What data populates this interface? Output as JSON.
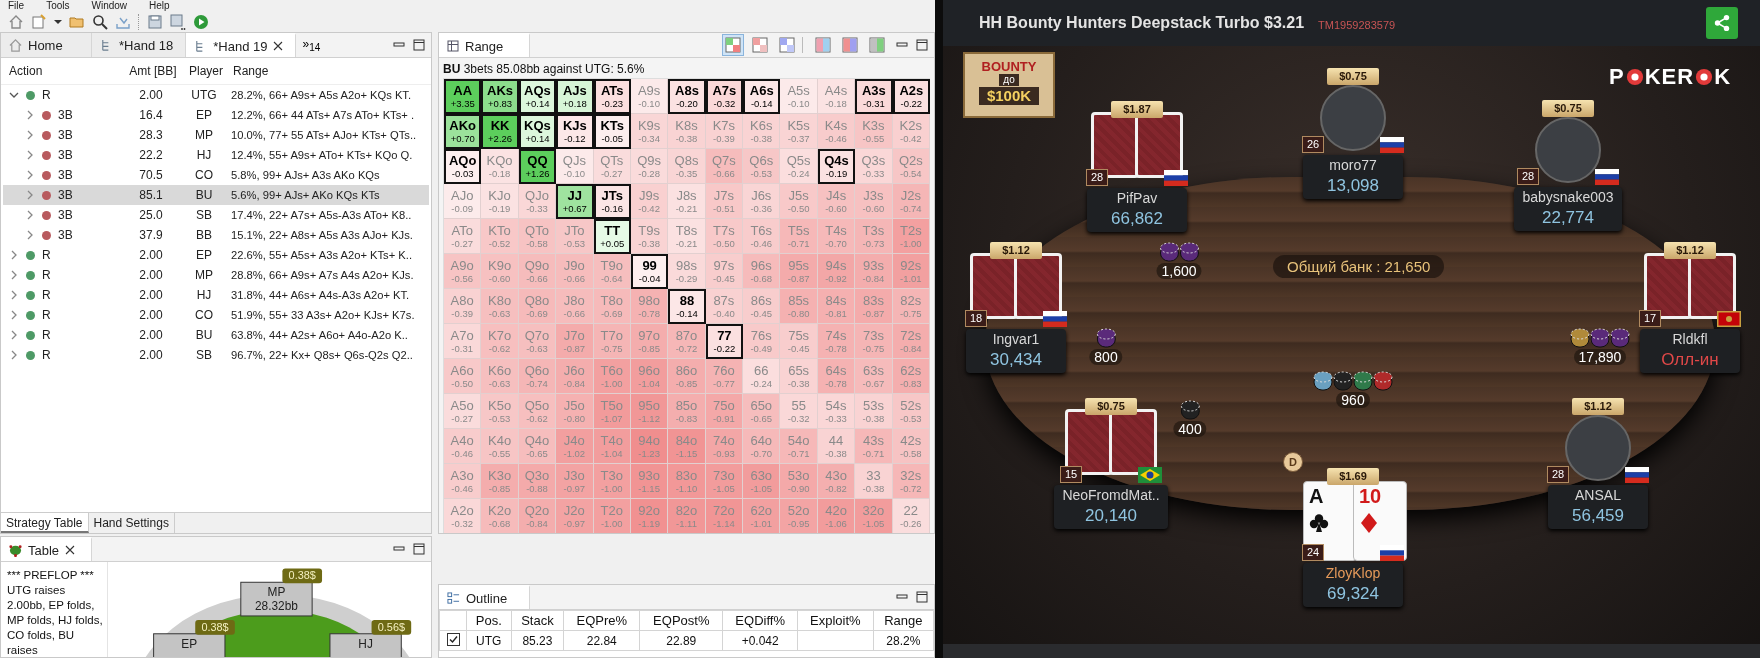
{
  "menu": [
    "File",
    "Tools",
    "Window",
    "Help"
  ],
  "strategy_table": {
    "tabs": [
      {
        "label": "Home",
        "selected": false,
        "closable": false
      },
      {
        "label": "*Hand 18",
        "selected": false,
        "closable": false
      },
      {
        "label": "*Hand 19",
        "selected": true,
        "closable": true
      }
    ],
    "overflow": {
      "mark": "»",
      "count": "14"
    },
    "columns": [
      "Action",
      "Amt [BB]",
      "Player",
      "Range"
    ],
    "rows": [
      {
        "action": "R",
        "amount": "2.00",
        "player": "UTG",
        "range": "28.2%, 66+ A9s+ A5s A2o+ KQs KT.",
        "color": "#4e9a66",
        "expanded": true,
        "selected": false,
        "children": [
          {
            "action": "3B",
            "amount": "16.4",
            "player": "EP",
            "range": "12.2%, 66+ 44 ATs+ A7s ATo+ KTs+ .",
            "color": "#b85a5e",
            "expanded": false,
            "selected": false
          },
          {
            "action": "3B",
            "amount": "28.3",
            "player": "MP",
            "range": "10.0%, 77+ 55 ATs+ AJo+ KTs+ QTs..",
            "color": "#b85a5e",
            "expanded": false,
            "selected": false
          },
          {
            "action": "3B",
            "amount": "22.2",
            "player": "HJ",
            "range": "12.4%, 55+ A9s+ ATo+ KTs+ KQo Q.",
            "color": "#b85a5e",
            "expanded": false,
            "selected": false
          },
          {
            "action": "3B",
            "amount": "70.5",
            "player": "CO",
            "range": "5.8%, 99+ AJs+ A3s AKo KQs",
            "color": "#b85a5e",
            "expanded": false,
            "selected": false
          },
          {
            "action": "3B",
            "amount": "85.1",
            "player": "BU",
            "range": "5.6%, 99+ AJs+ AKo KQs KTs",
            "color": "#b85a5e",
            "expanded": false,
            "selected": true
          },
          {
            "action": "3B",
            "amount": "25.0",
            "player": "SB",
            "range": "17.4%, 22+ A7s+ A5s-A3s ATo+ K8..",
            "color": "#b85a5e",
            "expanded": false,
            "selected": false
          },
          {
            "action": "3B",
            "amount": "37.9",
            "player": "BB",
            "range": "15.1%, 22+ A8s+ A5s A3s AJo+ KJs.",
            "color": "#b85a5e",
            "expanded": false,
            "selected": false
          }
        ]
      },
      {
        "action": "R",
        "amount": "2.00",
        "player": "EP",
        "range": "22.6%, 55+ A5s+ A3s A2o+ KTs+ K..",
        "color": "#4e9a66",
        "expanded": false,
        "selected": false
      },
      {
        "action": "R",
        "amount": "2.00",
        "player": "MP",
        "range": "28.8%, 66+ A9s+ A7s A4s A2o+ KJs.",
        "color": "#4e9a66",
        "expanded": false,
        "selected": false
      },
      {
        "action": "R",
        "amount": "2.00",
        "player": "HJ",
        "range": "31.8%, 44+ A6s+ A4s-A3s A2o+ KT.",
        "color": "#4e9a66",
        "expanded": false,
        "selected": false
      },
      {
        "action": "R",
        "amount": "2.00",
        "player": "CO",
        "range": "51.9%, 55+ 33 A3s+ A2o+ KJs+ K7s.",
        "color": "#4e9a66",
        "expanded": false,
        "selected": false
      },
      {
        "action": "R",
        "amount": "2.00",
        "player": "BU",
        "range": "63.8%, 44+ A2s+ A6o+ A4o-A2o K..",
        "color": "#4e9a66",
        "expanded": false,
        "selected": false
      },
      {
        "action": "R",
        "amount": "2.00",
        "player": "SB",
        "range": "96.7%, 22+ Kx+ Q8s+ Q6s-Q2s Q2..",
        "color": "#4e9a66",
        "expanded": false,
        "selected": false
      }
    ],
    "bottom_tabs": [
      {
        "label": "Strategy Table",
        "selected": true
      },
      {
        "label": "Hand Settings",
        "selected": false
      }
    ]
  },
  "range_panel": {
    "tab": "Range",
    "view_buttons": [
      {
        "selected": true
      },
      {
        "selected": false
      },
      {
        "selected": false
      },
      {
        "selected": false
      },
      {
        "selected": false
      },
      {
        "selected": false
      }
    ],
    "caption": "**BU** 3bets 85.08bb against UTG: 5.6%",
    "grid": [
      [
        {
          "hand": "AA",
          "ev": "+3.35",
          "selected": true
        },
        {
          "hand": "AKs",
          "ev": "+0.83",
          "selected": true
        },
        {
          "hand": "AQs",
          "ev": "+0.14",
          "selected": true
        },
        {
          "hand": "AJs",
          "ev": "+0.18",
          "selected": true
        },
        {
          "hand": "ATs",
          "ev": "-0.23",
          "selected": true
        },
        {
          "hand": "A9s",
          "ev": "-0.10",
          "selected": false
        },
        {
          "hand": "A8s",
          "ev": "-0.20",
          "selected": true
        },
        {
          "hand": "A7s",
          "ev": "-0.32",
          "selected": true
        },
        {
          "hand": "A6s",
          "ev": "-0.14",
          "selected": true
        },
        {
          "hand": "A5s",
          "ev": "-0.10",
          "selected": false
        },
        {
          "hand": "A4s",
          "ev": "-0.18",
          "selected": false
        },
        {
          "hand": "A3s",
          "ev": "-0.31",
          "selected": true
        },
        {
          "hand": "A2s",
          "ev": "-0.22",
          "selected": true
        }
      ],
      [
        {
          "hand": "AKo",
          "ev": "+0.70",
          "selected": true
        },
        {
          "hand": "KK",
          "ev": "+2.26",
          "selected": true
        },
        {
          "hand": "KQs",
          "ev": "+0.14",
          "selected": true
        },
        {
          "hand": "KJs",
          "ev": "-0.12",
          "selected": true
        },
        {
          "hand": "KTs",
          "ev": "-0.05",
          "selected": true
        },
        {
          "hand": "K9s",
          "ev": "-0.34",
          "selected": false
        },
        {
          "hand": "K8s",
          "ev": "-0.38",
          "selected": false
        },
        {
          "hand": "K7s",
          "ev": "-0.39",
          "selected": false
        },
        {
          "hand": "K6s",
          "ev": "-0.38",
          "selected": false
        },
        {
          "hand": "K5s",
          "ev": "-0.37",
          "selected": false
        },
        {
          "hand": "K4s",
          "ev": "-0.46",
          "selected": false
        },
        {
          "hand": "K3s",
          "ev": "-0.55",
          "selected": false
        },
        {
          "hand": "K2s",
          "ev": "-0.42",
          "selected": false
        }
      ],
      [
        {
          "hand": "AQo",
          "ev": "-0.03",
          "selected": true
        },
        {
          "hand": "KQo",
          "ev": "-0.18",
          "selected": false
        },
        {
          "hand": "QQ",
          "ev": "+1.26",
          "selected": true
        },
        {
          "hand": "QJs",
          "ev": "-0.10",
          "selected": false
        },
        {
          "hand": "QTs",
          "ev": "-0.27",
          "selected": false
        },
        {
          "hand": "Q9s",
          "ev": "-0.28",
          "selected": false
        },
        {
          "hand": "Q8s",
          "ev": "-0.35",
          "selected": false
        },
        {
          "hand": "Q7s",
          "ev": "-0.66",
          "selected": false
        },
        {
          "hand": "Q6s",
          "ev": "-0.53",
          "selected": false
        },
        {
          "hand": "Q5s",
          "ev": "-0.24",
          "selected": false
        },
        {
          "hand": "Q4s",
          "ev": "-0.19",
          "selected": true
        },
        {
          "hand": "Q3s",
          "ev": "-0.33",
          "selected": false
        },
        {
          "hand": "Q2s",
          "ev": "-0.54",
          "selected": false
        }
      ],
      [
        {
          "hand": "AJo",
          "ev": "-0.09",
          "selected": false
        },
        {
          "hand": "KJo",
          "ev": "-0.19",
          "selected": false
        },
        {
          "hand": "QJo",
          "ev": "-0.33",
          "selected": false
        },
        {
          "hand": "JJ",
          "ev": "+0.67",
          "selected": true
        },
        {
          "hand": "JTs",
          "ev": "-0.16",
          "selected": true
        },
        {
          "hand": "J9s",
          "ev": "-0.42",
          "selected": false
        },
        {
          "hand": "J8s",
          "ev": "-0.21",
          "selected": false
        },
        {
          "hand": "J7s",
          "ev": "-0.51",
          "selected": false
        },
        {
          "hand": "J6s",
          "ev": "-0.36",
          "selected": false
        },
        {
          "hand": "J5s",
          "ev": "-0.50",
          "selected": false
        },
        {
          "hand": "J4s",
          "ev": "-0.60",
          "selected": false
        },
        {
          "hand": "J3s",
          "ev": "-0.60",
          "selected": false
        },
        {
          "hand": "J2s",
          "ev": "-0.74",
          "selected": false
        }
      ],
      [
        {
          "hand": "ATo",
          "ev": "-0.27",
          "selected": false
        },
        {
          "hand": "KTo",
          "ev": "-0.52",
          "selected": false
        },
        {
          "hand": "QTo",
          "ev": "-0.58",
          "selected": false
        },
        {
          "hand": "JTo",
          "ev": "-0.53",
          "selected": false
        },
        {
          "hand": "TT",
          "ev": "+0.05",
          "selected": true
        },
        {
          "hand": "T9s",
          "ev": "-0.38",
          "selected": false
        },
        {
          "hand": "T8s",
          "ev": "-0.21",
          "selected": false
        },
        {
          "hand": "T7s",
          "ev": "-0.50",
          "selected": false
        },
        {
          "hand": "T6s",
          "ev": "-0.46",
          "selected": false
        },
        {
          "hand": "T5s",
          "ev": "-0.71",
          "selected": false
        },
        {
          "hand": "T4s",
          "ev": "-0.70",
          "selected": false
        },
        {
          "hand": "T3s",
          "ev": "-0.73",
          "selected": false
        },
        {
          "hand": "T2s",
          "ev": "-1.00",
          "selected": false
        }
      ],
      [
        {
          "hand": "A9o",
          "ev": "-0.56",
          "selected": false
        },
        {
          "hand": "K9o",
          "ev": "-0.60",
          "selected": false
        },
        {
          "hand": "Q9o",
          "ev": "-0.66",
          "selected": false
        },
        {
          "hand": "J9o",
          "ev": "-0.66",
          "selected": false
        },
        {
          "hand": "T9o",
          "ev": "-0.64",
          "selected": false
        },
        {
          "hand": "99",
          "ev": "-0.04",
          "selected": true
        },
        {
          "hand": "98s",
          "ev": "-0.29",
          "selected": false
        },
        {
          "hand": "97s",
          "ev": "-0.45",
          "selected": false
        },
        {
          "hand": "96s",
          "ev": "-0.68",
          "selected": false
        },
        {
          "hand": "95s",
          "ev": "-0.87",
          "selected": false
        },
        {
          "hand": "94s",
          "ev": "-0.92",
          "selected": false
        },
        {
          "hand": "93s",
          "ev": "-0.84",
          "selected": false
        },
        {
          "hand": "92s",
          "ev": "-1.01",
          "selected": false
        }
      ],
      [
        {
          "hand": "A8o",
          "ev": "-0.39",
          "selected": false
        },
        {
          "hand": "K8o",
          "ev": "-0.63",
          "selected": false
        },
        {
          "hand": "Q8o",
          "ev": "-0.69",
          "selected": false
        },
        {
          "hand": "J8o",
          "ev": "-0.66",
          "selected": false
        },
        {
          "hand": "T8o",
          "ev": "-0.69",
          "selected": false
        },
        {
          "hand": "98o",
          "ev": "-0.78",
          "selected": false
        },
        {
          "hand": "88",
          "ev": "-0.14",
          "selected": true
        },
        {
          "hand": "87s",
          "ev": "-0.40",
          "selected": false
        },
        {
          "hand": "86s",
          "ev": "-0.45",
          "selected": false
        },
        {
          "hand": "85s",
          "ev": "-0.80",
          "selected": false
        },
        {
          "hand": "84s",
          "ev": "-0.81",
          "selected": false
        },
        {
          "hand": "83s",
          "ev": "-0.87",
          "selected": false
        },
        {
          "hand": "82s",
          "ev": "-0.75",
          "selected": false
        }
      ],
      [
        {
          "hand": "A7o",
          "ev": "-0.31",
          "selected": false
        },
        {
          "hand": "K7o",
          "ev": "-0.62",
          "selected": false
        },
        {
          "hand": "Q7o",
          "ev": "-0.63",
          "selected": false
        },
        {
          "hand": "J7o",
          "ev": "-0.87",
          "selected": false
        },
        {
          "hand": "T7o",
          "ev": "-0.75",
          "selected": false
        },
        {
          "hand": "97o",
          "ev": "-0.85",
          "selected": false
        },
        {
          "hand": "87o",
          "ev": "-0.72",
          "selected": false
        },
        {
          "hand": "77",
          "ev": "-0.22",
          "selected": true
        },
        {
          "hand": "76s",
          "ev": "-0.49",
          "selected": false
        },
        {
          "hand": "75s",
          "ev": "-0.45",
          "selected": false
        },
        {
          "hand": "74s",
          "ev": "-0.78",
          "selected": false
        },
        {
          "hand": "73s",
          "ev": "-0.75",
          "selected": false
        },
        {
          "hand": "72s",
          "ev": "-0.84",
          "selected": false
        }
      ],
      [
        {
          "hand": "A6o",
          "ev": "-0.50",
          "selected": false
        },
        {
          "hand": "K6o",
          "ev": "-0.63",
          "selected": false
        },
        {
          "hand": "Q6o",
          "ev": "-0.74",
          "selected": false
        },
        {
          "hand": "J6o",
          "ev": "-0.84",
          "selected": false
        },
        {
          "hand": "T6o",
          "ev": "-1.00",
          "selected": false
        },
        {
          "hand": "96o",
          "ev": "-1.04",
          "selected": false
        },
        {
          "hand": "86o",
          "ev": "-0.85",
          "selected": false
        },
        {
          "hand": "76o",
          "ev": "-0.77",
          "selected": false
        },
        {
          "hand": "66",
          "ev": "-0.24",
          "selected": false
        },
        {
          "hand": "65s",
          "ev": "-0.38",
          "selected": false
        },
        {
          "hand": "64s",
          "ev": "-0.78",
          "selected": false
        },
        {
          "hand": "63s",
          "ev": "-0.67",
          "selected": false
        },
        {
          "hand": "62s",
          "ev": "-0.83",
          "selected": false
        }
      ],
      [
        {
          "hand": "A5o",
          "ev": "-0.27",
          "selected": false
        },
        {
          "hand": "K5o",
          "ev": "-0.53",
          "selected": false
        },
        {
          "hand": "Q5o",
          "ev": "-0.62",
          "selected": false
        },
        {
          "hand": "J5o",
          "ev": "-0.80",
          "selected": false
        },
        {
          "hand": "T5o",
          "ev": "-1.07",
          "selected": false
        },
        {
          "hand": "95o",
          "ev": "-1.12",
          "selected": false
        },
        {
          "hand": "85o",
          "ev": "-0.83",
          "selected": false
        },
        {
          "hand": "75o",
          "ev": "-0.91",
          "selected": false
        },
        {
          "hand": "65o",
          "ev": "-0.65",
          "selected": false
        },
        {
          "hand": "55",
          "ev": "-0.32",
          "selected": false
        },
        {
          "hand": "54s",
          "ev": "-0.33",
          "selected": false
        },
        {
          "hand": "53s",
          "ev": "-0.38",
          "selected": false
        },
        {
          "hand": "52s",
          "ev": "-0.53",
          "selected": false
        }
      ],
      [
        {
          "hand": "A4o",
          "ev": "-0.46",
          "selected": false
        },
        {
          "hand": "K4o",
          "ev": "-0.55",
          "selected": false
        },
        {
          "hand": "Q4o",
          "ev": "-0.65",
          "selected": false
        },
        {
          "hand": "J4o",
          "ev": "-1.02",
          "selected": false
        },
        {
          "hand": "T4o",
          "ev": "-1.04",
          "selected": false
        },
        {
          "hand": "94o",
          "ev": "-1.23",
          "selected": false
        },
        {
          "hand": "84o",
          "ev": "-1.15",
          "selected": false
        },
        {
          "hand": "74o",
          "ev": "-0.93",
          "selected": false
        },
        {
          "hand": "64o",
          "ev": "-0.70",
          "selected": false
        },
        {
          "hand": "54o",
          "ev": "-0.71",
          "selected": false
        },
        {
          "hand": "44",
          "ev": "-0.38",
          "selected": false
        },
        {
          "hand": "43s",
          "ev": "-0.71",
          "selected": false
        },
        {
          "hand": "42s",
          "ev": "-0.58",
          "selected": false
        }
      ],
      [
        {
          "hand": "A3o",
          "ev": "-0.46",
          "selected": false
        },
        {
          "hand": "K3o",
          "ev": "-0.85",
          "selected": false
        },
        {
          "hand": "Q3o",
          "ev": "-0.88",
          "selected": false
        },
        {
          "hand": "J3o",
          "ev": "-0.97",
          "selected": false
        },
        {
          "hand": "T3o",
          "ev": "-1.00",
          "selected": false
        },
        {
          "hand": "93o",
          "ev": "-1.15",
          "selected": false
        },
        {
          "hand": "83o",
          "ev": "-1.10",
          "selected": false
        },
        {
          "hand": "73o",
          "ev": "-1.05",
          "selected": false
        },
        {
          "hand": "63o",
          "ev": "-1.05",
          "selected": false
        },
        {
          "hand": "53o",
          "ev": "-0.90",
          "selected": false
        },
        {
          "hand": "43o",
          "ev": "-0.82",
          "selected": false
        },
        {
          "hand": "33",
          "ev": "-0.38",
          "selected": false
        },
        {
          "hand": "32s",
          "ev": "-0.72",
          "selected": false
        }
      ],
      [
        {
          "hand": "A2o",
          "ev": "-0.32",
          "selected": false
        },
        {
          "hand": "K2o",
          "ev": "-0.68",
          "selected": false
        },
        {
          "hand": "Q2o",
          "ev": "-0.84",
          "selected": false
        },
        {
          "hand": "J2o",
          "ev": "-0.97",
          "selected": false
        },
        {
          "hand": "T2o",
          "ev": "-1.00",
          "selected": false
        },
        {
          "hand": "92o",
          "ev": "-1.19",
          "selected": false
        },
        {
          "hand": "82o",
          "ev": "-1.11",
          "selected": false
        },
        {
          "hand": "72o",
          "ev": "-1.14",
          "selected": false
        },
        {
          "hand": "62o",
          "ev": "-1.01",
          "selected": false
        },
        {
          "hand": "52o",
          "ev": "-0.95",
          "selected": false
        },
        {
          "hand": "42o",
          "ev": "-1.06",
          "selected": false
        },
        {
          "hand": "32o",
          "ev": "-1.05",
          "selected": false
        },
        {
          "hand": "22",
          "ev": "-0.26",
          "selected": false
        }
      ]
    ]
  },
  "table_panel": {
    "tab": "Table",
    "log": "*** PREFLOP *** UTG raises 2.00bb, EP folds, MP folds, HJ folds, CO folds, BU raises",
    "seats": [
      {
        "position": "EP",
        "bet": "0.38$"
      },
      {
        "position": "MP",
        "stack": "28.32bb",
        "bet": "0.38$"
      },
      {
        "position": "HJ",
        "bet": "0.56$"
      }
    ]
  },
  "outline": {
    "tab": "Outline",
    "columns": [
      "Pos.",
      "Stack",
      "EQPre%",
      "EQPost%",
      "EQDiff%",
      "Exploit%",
      "Range"
    ],
    "rows": [
      {
        "checked": true,
        "pos": "UTG",
        "stack": "85.23",
        "eq_pre": "22.84",
        "eq_post": "22.89",
        "eq_diff": "+0.042",
        "range": "28.2%"
      }
    ]
  },
  "poker": {
    "title": "HH Bounty Hunters Deepstack Turbo $3.21",
    "tournament_id": "TM1959283579",
    "promo": [
      "BOUNTY",
      "до",
      "$100K"
    ],
    "logo": [
      "P",
      "KER",
      "K"
    ],
    "pot": "Общий банк : 21,650",
    "dealer": "D",
    "seats": [
      {
        "name": "PifPav",
        "stack": "66,862",
        "bounty": "$1.87",
        "level": "28",
        "kind": "backs",
        "hero": false,
        "all_in": false
      },
      {
        "name": "moro77",
        "stack": "13,098",
        "bounty": "$0.75",
        "level": "26",
        "kind": "avatar",
        "hero": false,
        "all_in": false
      },
      {
        "name": "babysnake003",
        "stack": "22,774",
        "bounty": "$0.75",
        "level": "28",
        "kind": "avatar",
        "hero": false,
        "all_in": false
      },
      {
        "name": "Ingvar1",
        "stack": "30,434",
        "bounty": "$1.12",
        "level": "18",
        "kind": "backs",
        "hero": false,
        "all_in": false
      },
      {
        "name": "Rldkfl",
        "stack": "Олл-ин",
        "bounty": "$1.12",
        "level": "17",
        "kind": "backs",
        "hero": false,
        "all_in": true
      },
      {
        "name": "NeoFromdMat..",
        "stack": "20,140",
        "bounty": "$0.75",
        "level": "15",
        "kind": "backs",
        "hero": false,
        "all_in": false
      },
      {
        "name": "ZloyKlop",
        "stack": "69,324",
        "bounty": "$1.69",
        "level": "24",
        "kind": "faceup",
        "hero": true,
        "all_in": false,
        "cards": [
          {
            "rank": "A",
            "kind": "clubs"
          },
          {
            "rank": "10",
            "kind": "diamonds"
          }
        ]
      },
      {
        "name": "ANSAL",
        "stack": "56,459",
        "bounty": "$1.12",
        "level": "28",
        "kind": "avatar",
        "hero": false,
        "all_in": false
      }
    ],
    "bets": [
      {
        "amount": "1,600"
      },
      {
        "amount": "800"
      },
      {
        "amount": "17,890"
      },
      {
        "amount": "400"
      },
      {
        "amount": "960"
      }
    ]
  }
}
